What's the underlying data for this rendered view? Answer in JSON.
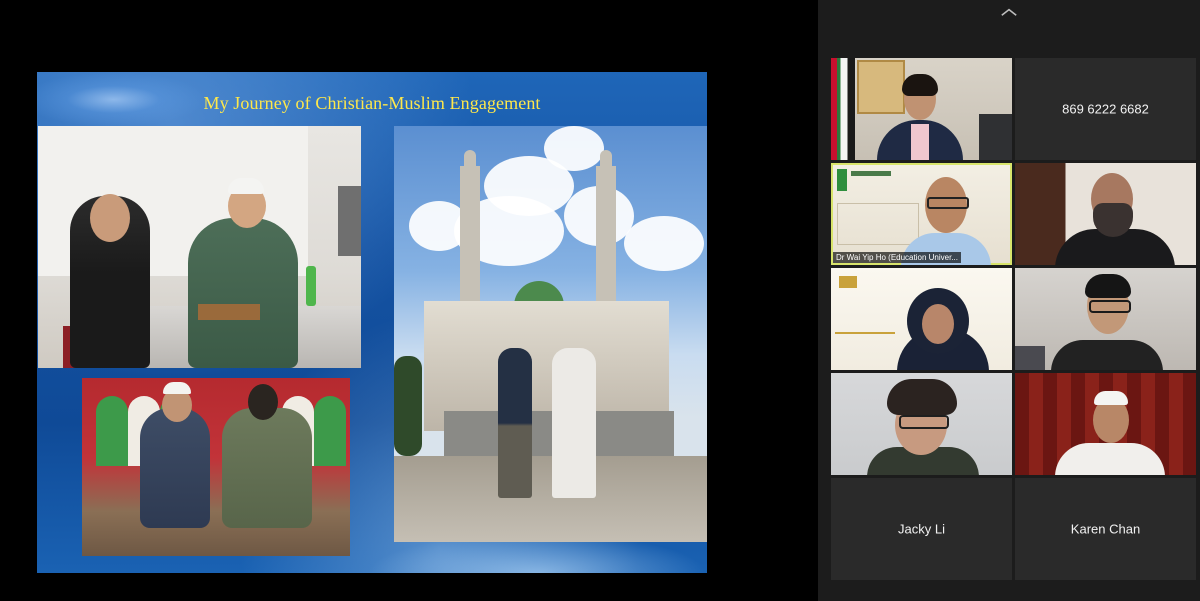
{
  "slide": {
    "title": "My Journey of Christian-Muslim Engagement"
  },
  "gallery": {
    "collapse_icon": "chevron-up-icon",
    "tiles": [
      {
        "kind": "video",
        "label": ""
      },
      {
        "kind": "text",
        "text": "869 6222 6682"
      },
      {
        "kind": "video",
        "label": "Dr Wai Yip Ho (Education Univer...",
        "active": true
      },
      {
        "kind": "video",
        "label": ""
      },
      {
        "kind": "video",
        "label": ""
      },
      {
        "kind": "video",
        "label": ""
      },
      {
        "kind": "video",
        "label": ""
      },
      {
        "kind": "video",
        "label": ""
      },
      {
        "kind": "text",
        "text": "Jacky Li"
      },
      {
        "kind": "text",
        "text": "Karen Chan"
      }
    ]
  },
  "colors": {
    "slide_title": "#ffe84a",
    "active_speaker_border": "#d8e46b",
    "gallery_bg": "#1c1c1c",
    "tile_bg": "#2a2a2a"
  }
}
